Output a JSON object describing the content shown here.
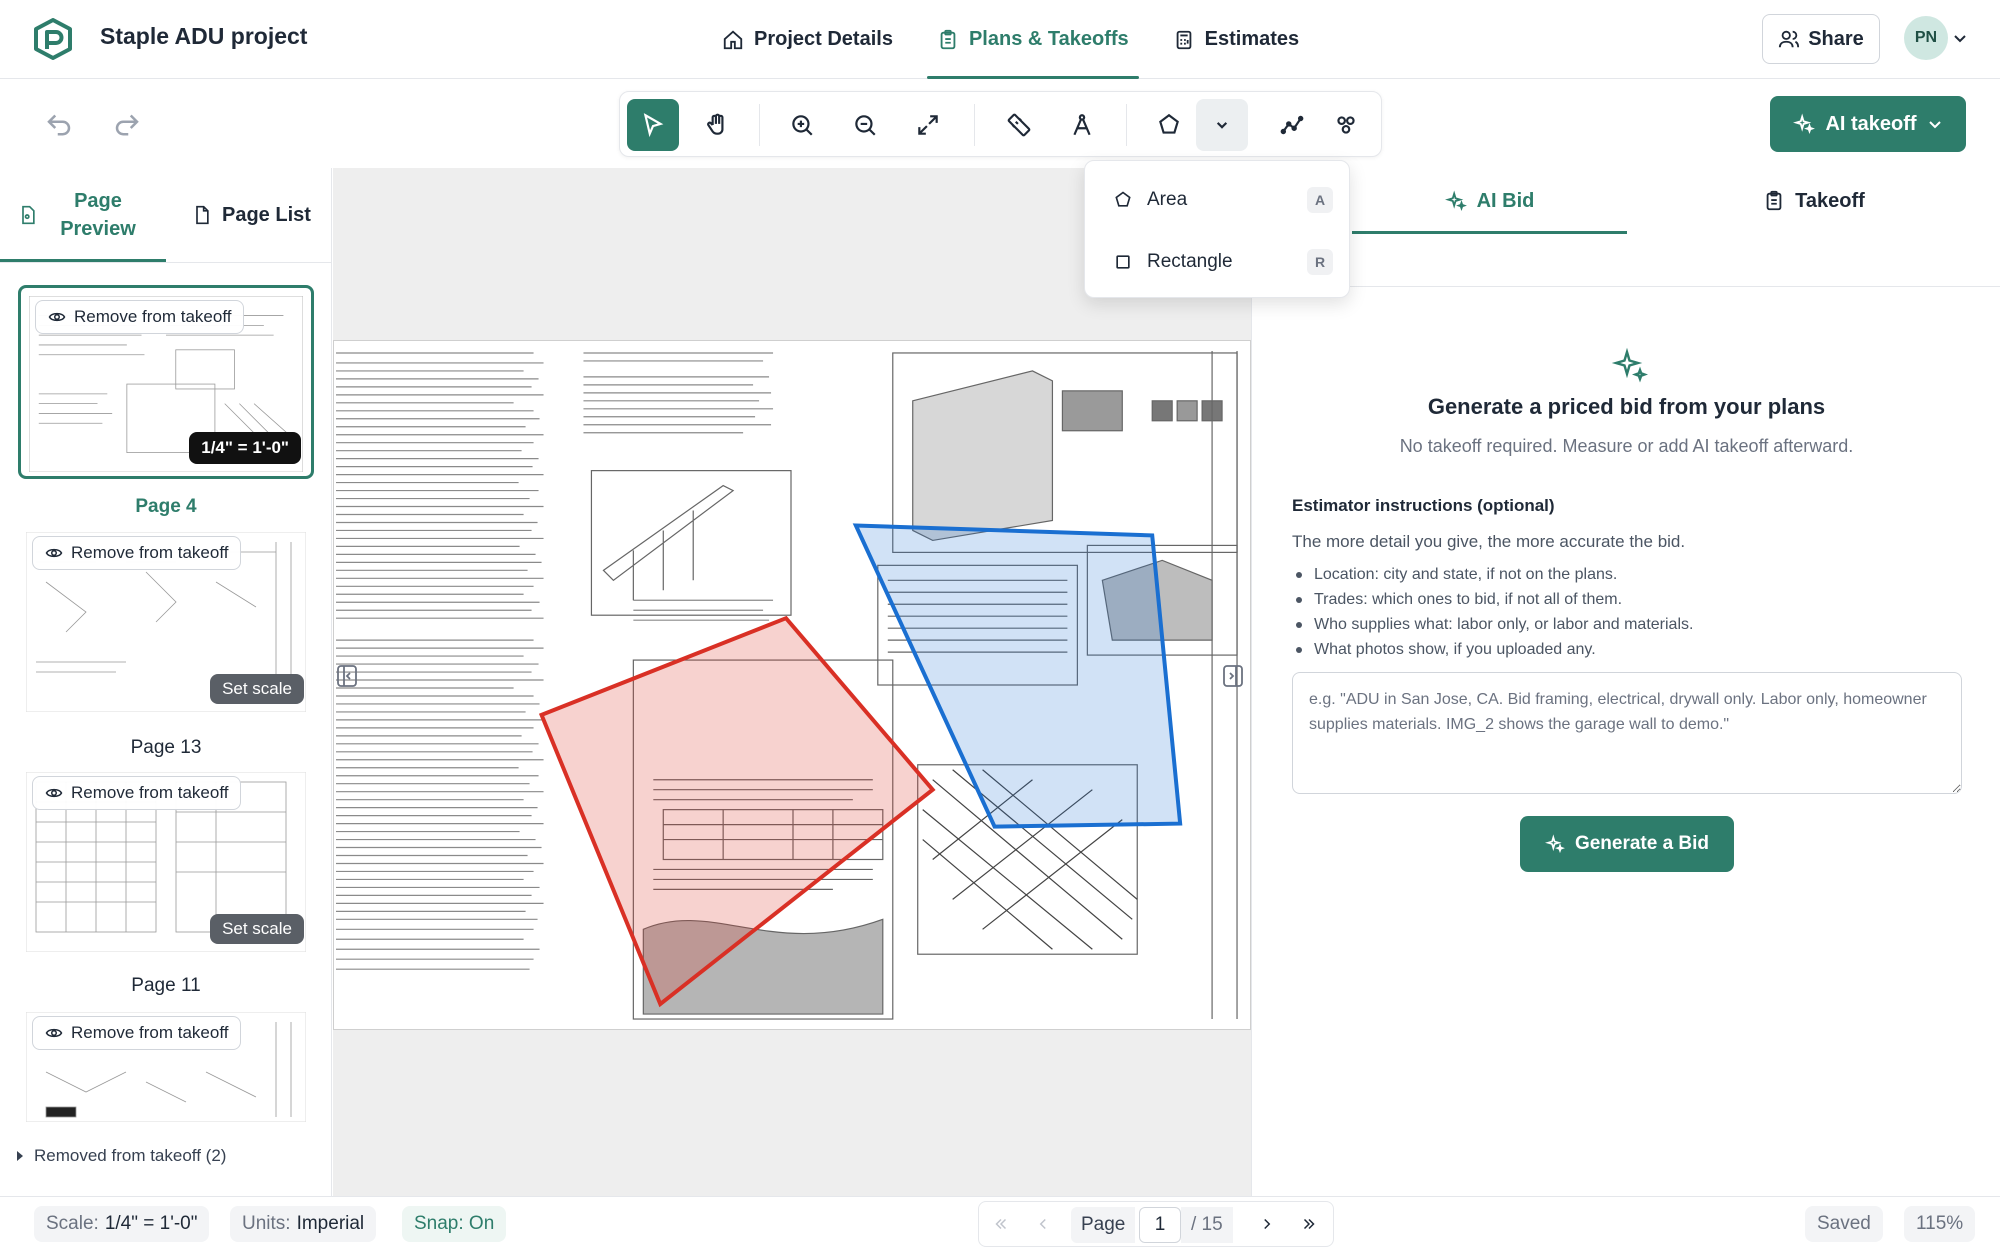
{
  "header": {
    "project_title": "Staple ADU project",
    "nav": [
      {
        "label": "Project Details",
        "icon": "home-icon"
      },
      {
        "label": "Plans & Takeoffs",
        "icon": "clipboard-icon",
        "active": true
      },
      {
        "label": "Estimates",
        "icon": "calculator-icon"
      }
    ],
    "share_label": "Share",
    "avatar_initials": "PN"
  },
  "toolbar": {
    "tools": [
      "select-tool",
      "pan-tool",
      "zoom-in-tool",
      "zoom-out-tool",
      "fit-tool",
      "measure-tool",
      "count-tool",
      "area-tool",
      "area-dropdown",
      "polyline-tool",
      "group-tool"
    ],
    "ai_takeoff_label": "AI takeoff"
  },
  "dropdown": {
    "items": [
      {
        "label": "Area",
        "shortcut": "A",
        "icon": "star-icon"
      },
      {
        "label": "Rectangle",
        "shortcut": "R",
        "icon": "square-icon"
      }
    ]
  },
  "left_panel": {
    "tabs": [
      {
        "label": "Page Preview",
        "active": true
      },
      {
        "label": "Page List"
      }
    ],
    "remove_label": "Remove from takeoff",
    "thumbnails": [
      {
        "label": "Page 4",
        "scale": "1/4\" = 1'-0\"",
        "selected": true
      },
      {
        "label": "Page 13",
        "scale_action": "Set scale"
      },
      {
        "label": "Page 11",
        "scale_action": "Set scale"
      },
      {
        "label": ""
      }
    ],
    "removed_label": "Removed from takeoff (2)"
  },
  "right_panel": {
    "tabs": [
      {
        "label": "AI Bid",
        "active": true
      },
      {
        "label": "Takeoff"
      }
    ],
    "title": "Generate a priced bid from your plans",
    "subtitle": "No takeoff required. Measure or add AI takeoff afterward.",
    "instructions_label": "Estimator instructions (optional)",
    "instructions_help": "The more detail you give, the more accurate the bid.",
    "instructions_list": [
      "Location: city and state, if not on the plans.",
      "Trades: which ones to bid, if not all of them.",
      "Who supplies what: labor only, or labor and materials.",
      "What photos show, if you uploaded any."
    ],
    "instructions_placeholder": "e.g. \"ADU in San Jose, CA. Bid framing, electrical, drywall only. Labor only, homeowner supplies materials. IMG_2 shows the garage wall to demo.\"",
    "generate_label": "Generate a Bid"
  },
  "status": {
    "scale_label": "Scale:",
    "scale_value": "1/4\" = 1'-0\"",
    "units_label": "Units:",
    "units_value": "Imperial",
    "snap": "Snap: On",
    "page_label": "Page",
    "page_current": "1",
    "page_total": "/ 15",
    "saved": "Saved",
    "zoom": "115%"
  },
  "colors": {
    "accent": "#2e7d6b",
    "area_red": "#d93025",
    "area_blue": "#1a6fd1"
  }
}
